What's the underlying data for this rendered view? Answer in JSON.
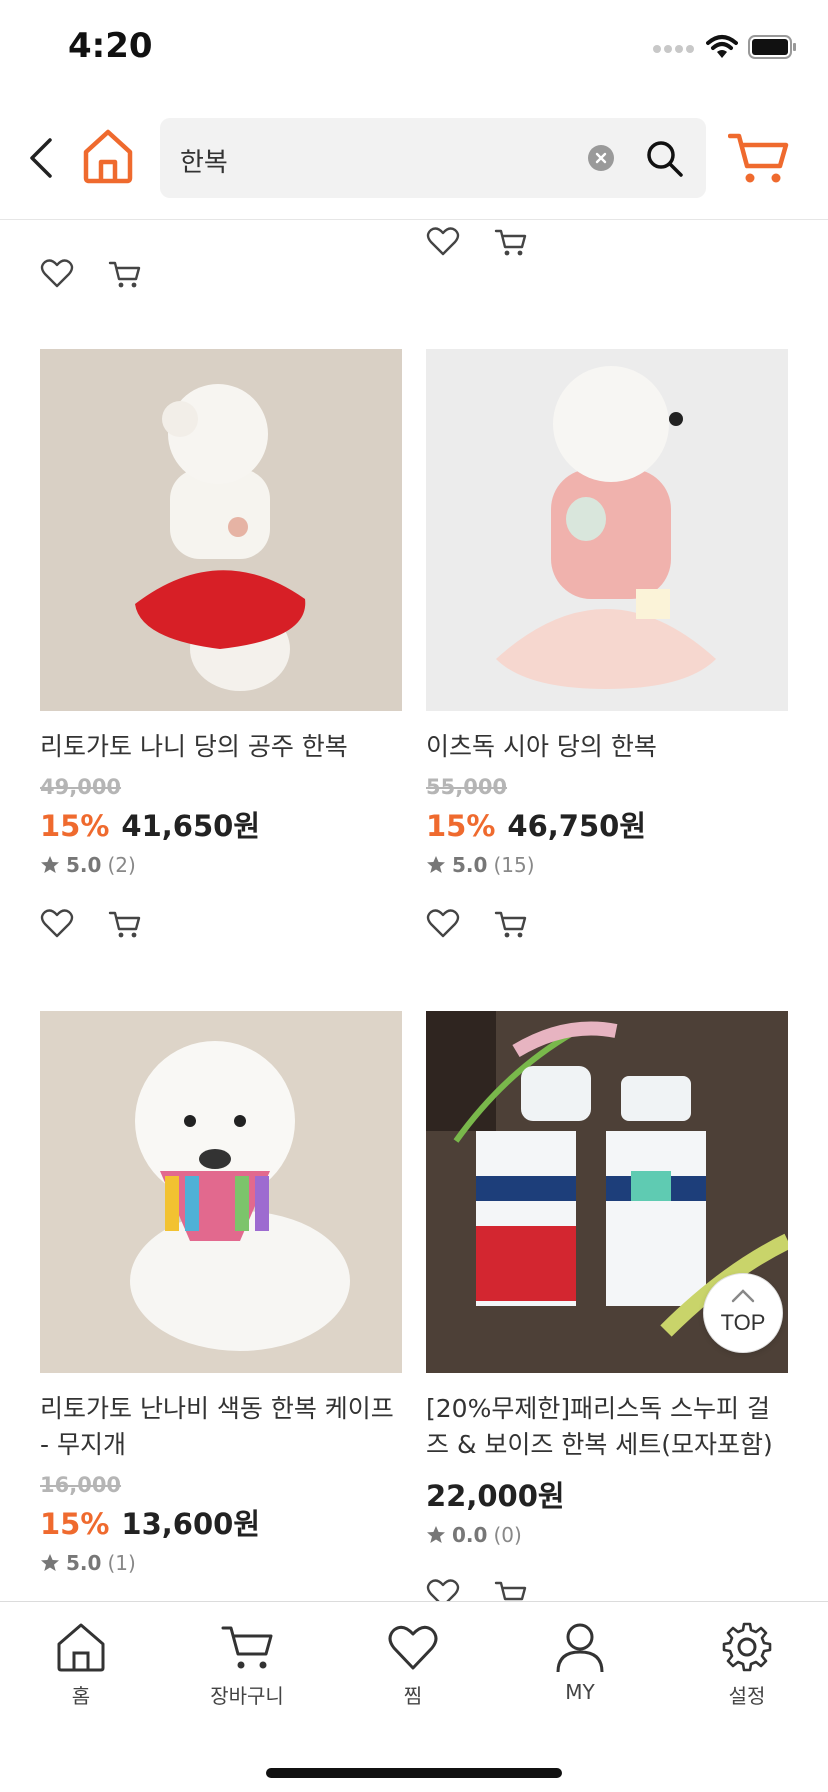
{
  "status_bar": {
    "time": "4:20"
  },
  "header": {
    "search_value": "한복",
    "icons": [
      "back-icon",
      "home-icon",
      "clear-icon",
      "search-icon",
      "cart-icon"
    ],
    "accent_color": "#ef6a2e"
  },
  "products": [
    {
      "title": "리토가토 나니 당의 공주 한복",
      "original_price": "49,000",
      "discount": "15%",
      "price": "41,650원",
      "rating": "5.0",
      "review_count": "(2)"
    },
    {
      "title": "이츠독 시아 당의 한복",
      "original_price": "55,000",
      "discount": "15%",
      "price": "46,750원",
      "rating": "5.0",
      "review_count": "(15)"
    },
    {
      "title": "리토가토 난나비 색동 한복 케이프 - 무지개",
      "original_price": "16,000",
      "discount": "15%",
      "price": "13,600원",
      "rating": "5.0",
      "review_count": "(1)"
    },
    {
      "title": "[20%무제한]패리스독 스누피 걸즈 & 보이즈 한복 세트(모자포함)",
      "original_price": "",
      "discount": "",
      "price": "22,000원",
      "rating": "0.0",
      "review_count": "(0)"
    }
  ],
  "top_button": {
    "label": "TOP"
  },
  "bottom_nav": [
    {
      "label": "홈",
      "icon": "home-icon"
    },
    {
      "label": "장바구니",
      "icon": "cart-icon"
    },
    {
      "label": "찜",
      "icon": "heart-icon"
    },
    {
      "label": "MY",
      "icon": "user-icon"
    },
    {
      "label": "설정",
      "icon": "gear-icon"
    }
  ]
}
